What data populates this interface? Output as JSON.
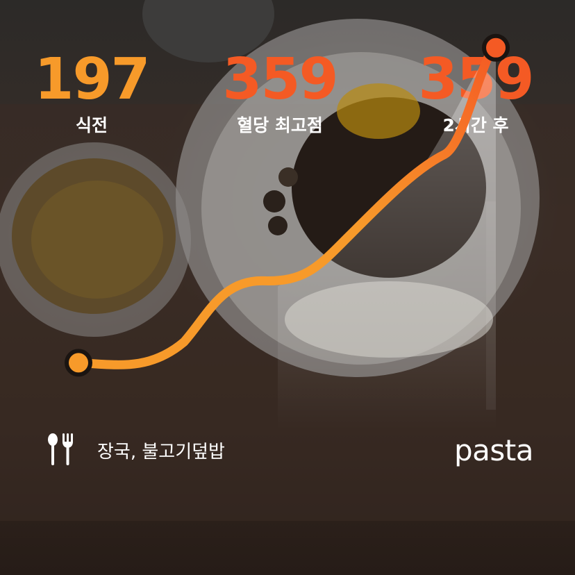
{
  "stats": [
    {
      "value": "197",
      "label": "식전",
      "color": "#f79a2a"
    },
    {
      "value": "359",
      "label": "혈당 최고점",
      "color": "#f45a24"
    },
    {
      "value": "359",
      "label": "2시간 후",
      "color": "#f45a24"
    }
  ],
  "meal": {
    "icon": "utensils-icon",
    "text": "장국, 불고기덮밥"
  },
  "brand": {
    "name": "pasta"
  },
  "colors": {
    "start": "#f79a2a",
    "end": "#f45a24",
    "marker_outline": "#1a1411"
  },
  "chart_data": {
    "type": "line",
    "series": [
      {
        "points": [
          {
            "y": 197
          },
          {
            "y": 359
          }
        ]
      }
    ],
    "annotations": [
      "식전",
      "2시간 후"
    ]
  }
}
